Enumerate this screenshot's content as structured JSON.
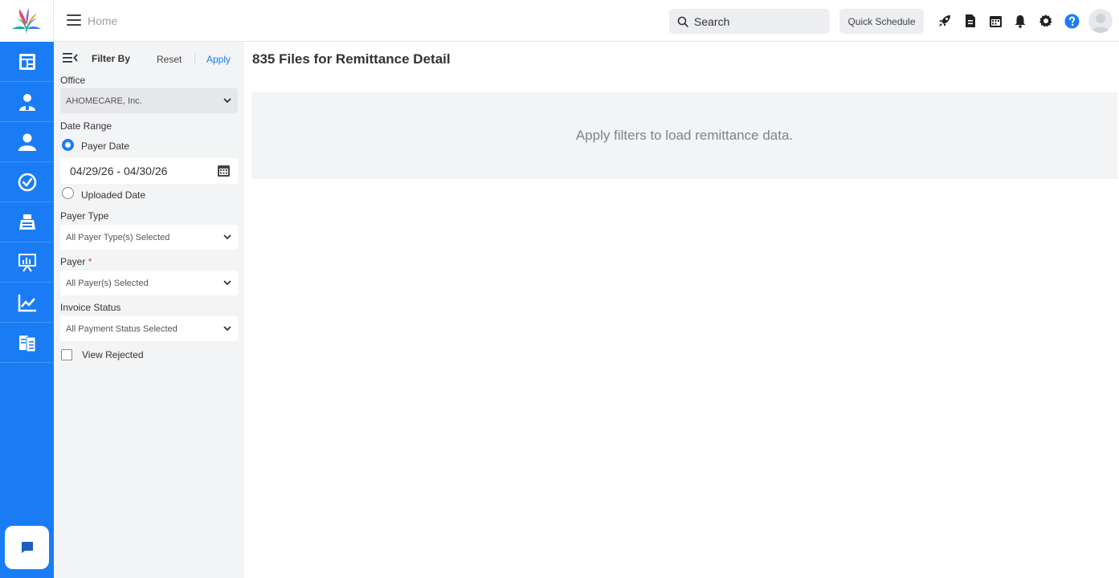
{
  "topbar": {
    "breadcrumb": "Home",
    "search_label": "Search",
    "quick_schedule_label": "Quick Schedule"
  },
  "filter": {
    "title": "Filter By",
    "reset_label": "Reset",
    "apply_label": "Apply",
    "office_label": "Office",
    "office_value": "AHOMECARE, Inc.",
    "date_range_label": "Date Range",
    "payer_date_label": "Payer Date",
    "date_range_value": "04/29/26 - 04/30/26",
    "uploaded_date_label": "Uploaded Date",
    "payer_type_label": "Payer Type",
    "payer_type_value": "All Payer Type(s) Selected",
    "payer_label": "Payer",
    "payer_required": "*",
    "payer_value": "All Payer(s) Selected",
    "invoice_status_label": "Invoice Status",
    "invoice_status_value": "All Payment Status Selected",
    "view_rejected_label": "View Rejected"
  },
  "main": {
    "title": "835 Files for Remittance Detail",
    "empty_message": "Apply filters to load remittance data."
  },
  "colors": {
    "accent": "#1a7cf5",
    "rail": "#1a7cf5",
    "panel": "#f3f4f6"
  },
  "icons": {
    "rail": [
      "dashboard-icon",
      "caregiver-icon",
      "client-icon",
      "clock-icon",
      "billing-icon",
      "presentation-icon",
      "chart-icon",
      "documents-icon"
    ],
    "topbar": [
      "rocket-icon",
      "document-icon",
      "calendar-icon",
      "bell-icon",
      "gear-icon",
      "help-icon"
    ]
  }
}
